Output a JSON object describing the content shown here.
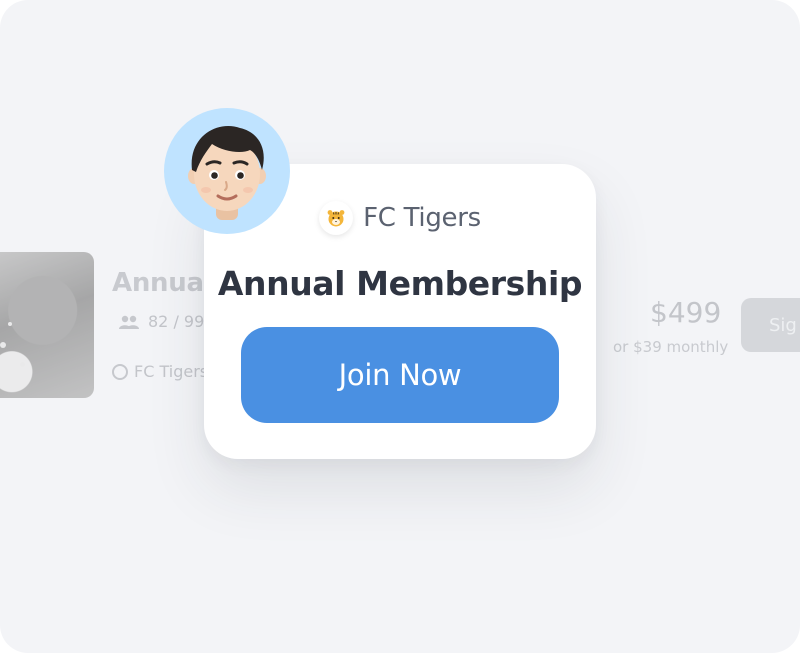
{
  "background_listing": {
    "title": "Annual",
    "member_count": "82 / 99",
    "club": "FC Tigers",
    "price": "$499",
    "monthly": "or $39 monthly",
    "button_label": "Sig"
  },
  "card": {
    "club_name": "FC Tigers",
    "club_logo_icon": "tiger-icon",
    "title": "Annual Membership",
    "join_label": "Join Now"
  },
  "avatar": {
    "icon": "person-avatar-icon"
  },
  "colors": {
    "accent": "#4a90e2",
    "avatar_bg": "#bfe3ff",
    "canvas_bg": "#f3f4f7"
  }
}
